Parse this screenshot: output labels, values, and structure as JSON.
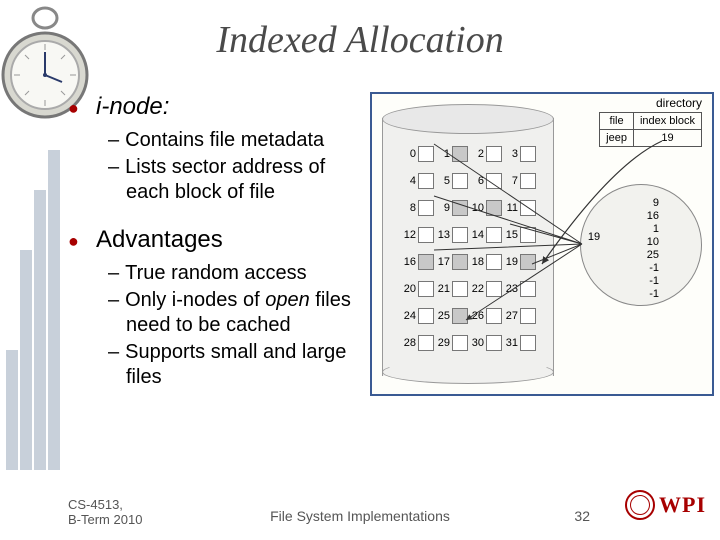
{
  "title": "Indexed Allocation",
  "bullets": {
    "b1": "i-node:",
    "b1_sub1": "Contains file metadata",
    "b1_sub2": "Lists sector address of each block of file",
    "b2": "Advantages",
    "b2_sub1": "True random access",
    "b2_sub2": "Only i-nodes of open files need to be cached",
    "b2_sub3": "Supports small and large files"
  },
  "diagram": {
    "directory_label": "directory",
    "dir_headers": {
      "c1": "file",
      "c2": "index block"
    },
    "dir_row": {
      "file": "jeep",
      "block": "19"
    },
    "index_label": "19",
    "index_values": [
      "9",
      "16",
      "1",
      "10",
      "25",
      "-1",
      "-1",
      "-1"
    ],
    "filled_cells": [
      1,
      9,
      10,
      16,
      17,
      19,
      25
    ],
    "cells": 32
  },
  "footer": {
    "course": "CS-4513, B-Term 2010",
    "topic": "File System Implementations",
    "page": "32",
    "logo": "WPI"
  }
}
